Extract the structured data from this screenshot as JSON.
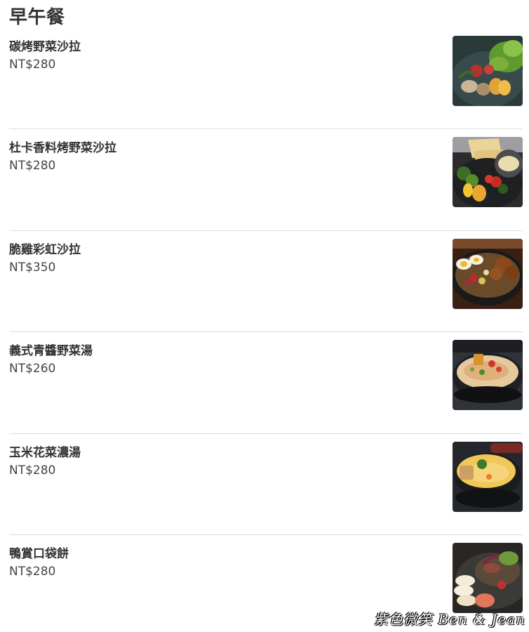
{
  "section": {
    "title": "早午餐"
  },
  "items": [
    {
      "name": "碳烤野菜沙拉",
      "price": "NT$280",
      "photo_icon": "grilled-vegetable-salad-photo"
    },
    {
      "name": "杜卡香料烤野菜沙拉",
      "price": "NT$280",
      "photo_icon": "dukkah-roasted-vegetable-salad-photo"
    },
    {
      "name": "脆雞彩虹沙拉",
      "price": "NT$350",
      "photo_icon": "crispy-chicken-rainbow-salad-photo"
    },
    {
      "name": "義式青醬野菜湯",
      "price": "NT$260",
      "photo_icon": "pesto-vegetable-soup-photo"
    },
    {
      "name": "玉米花菜濃湯",
      "price": "NT$280",
      "photo_icon": "corn-cauliflower-soup-photo"
    },
    {
      "name": "鴨賞口袋餅",
      "price": "NT$280",
      "photo_icon": "smoked-duck-pocket-bread-photo"
    }
  ],
  "watermark": {
    "text": "紫色微笑 Ben & Jean"
  },
  "colors": {
    "text": "#333333",
    "divider": "#dcdcdc",
    "background": "#ffffff"
  }
}
